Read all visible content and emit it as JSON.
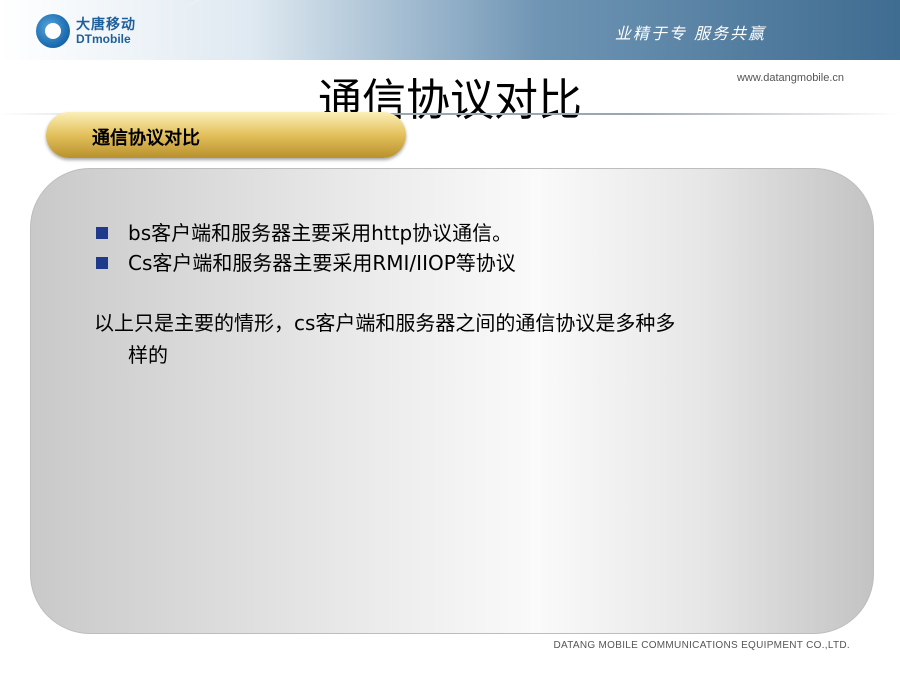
{
  "header": {
    "logo_cn": "大唐移动",
    "logo_en": "DTmobile",
    "slogan": "业精于专 服务共赢",
    "website": "www.datangmobile.cn"
  },
  "slide": {
    "title": "通信协议对比",
    "section_tab": "通信协议对比",
    "bullets": [
      "bs客户端和服务器主要采用http协议通信。",
      "Cs客户端和服务器主要采用RMI/IIOP等协议"
    ],
    "note_line1": "以上只是主要的情形，cs客户端和服务器之间的通信协议是多种多",
    "note_line2": "样的"
  },
  "footer": {
    "company": "DATANG MOBILE COMMUNICATIONS EQUIPMENT CO.,LTD."
  },
  "colors": {
    "bullet_square": "#1f3a8a",
    "tab_gold": "#e3c05b",
    "header_blue": "#3f6c91"
  }
}
